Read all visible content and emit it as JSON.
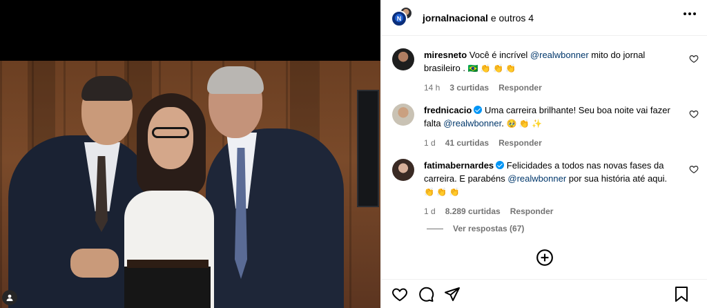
{
  "post": {
    "author": "jornalnacional",
    "coauthors_text": "e outros 4",
    "avatar_initials": "N"
  },
  "comments": [
    {
      "username": "miresneto",
      "text_before": "Você é incrível ",
      "mention": "@realwbonner",
      "text_after": " mito do jornal brasileiro . ",
      "emojis": "🇧🇷 👏 👏 👏",
      "time": "14 h",
      "likes": "3 curtidas",
      "reply": "Responder",
      "verified": false
    },
    {
      "username": "frednicacio",
      "text_before": "Uma carreira brilhante! Seu boa noite vai fazer falta ",
      "mention": "@realwbonner",
      "text_after": ". ",
      "emojis": "🥹 👏 ✨",
      "time": "1 d",
      "likes": "41 curtidas",
      "reply": "Responder",
      "verified": true
    },
    {
      "username": "fatimabernardes",
      "text_before": "Felicidades a todos nas novas fases da carreira. E parabéns ",
      "mention": "@realwbonner",
      "text_after": " por sua história até aqui. ",
      "emojis": "👏 👏 👏",
      "time": "1 d",
      "likes": "8.289 curtidas",
      "reply": "Responder",
      "verified": true
    }
  ],
  "view_replies": "Ver respostas (67)",
  "colors": {
    "mention": "#00376b",
    "verified": "#0095f6",
    "meta": "#737373"
  },
  "icons": [
    "more-options-icon",
    "heart-icon",
    "add-circle-icon",
    "like-icon",
    "comment-icon",
    "share-icon",
    "save-icon",
    "user-tag-icon"
  ]
}
